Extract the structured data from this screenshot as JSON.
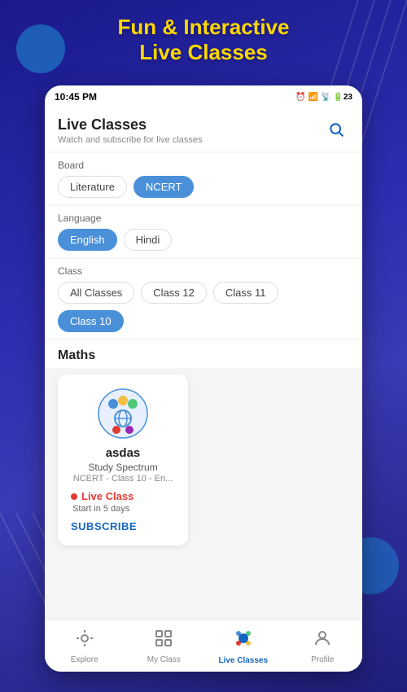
{
  "header": {
    "title_line1": "Fun & Interactive",
    "title_line2": "Live Classes"
  },
  "status_bar": {
    "time": "10:45 PM",
    "alarm_icon": "alarm-icon",
    "wifi_icon": "wifi-icon",
    "signal_icon": "signal-icon",
    "battery": "23"
  },
  "app": {
    "title": "Live Classes",
    "subtitle": "Watch and subscribe for live classes",
    "search_icon": "search-icon"
  },
  "filters": {
    "board": {
      "label": "Board",
      "options": [
        {
          "id": "literature",
          "label": "Literature",
          "active": false
        },
        {
          "id": "ncert",
          "label": "NCERT",
          "active": true
        }
      ]
    },
    "language": {
      "label": "Language",
      "options": [
        {
          "id": "english",
          "label": "English",
          "active": true
        },
        {
          "id": "hindi",
          "label": "Hindi",
          "active": false
        }
      ]
    },
    "class": {
      "label": "Class",
      "options": [
        {
          "id": "all",
          "label": "All Classes",
          "active": false
        },
        {
          "id": "class12",
          "label": "Class 12",
          "active": false
        },
        {
          "id": "class11",
          "label": "Class 11",
          "active": false
        },
        {
          "id": "class10",
          "label": "Class 10",
          "active": true
        }
      ]
    }
  },
  "subject": {
    "name": "Maths"
  },
  "card": {
    "icon_label": "class-icon",
    "title": "asdas",
    "provider": "Study Spectrum",
    "meta": "NCERT - Class 10 - En...",
    "live_status": "Live Class",
    "start_info": "Start in 5 days",
    "subscribe_label": "SUBSCRIBE"
  },
  "bottom_nav": {
    "items": [
      {
        "id": "explore",
        "label": "Explore",
        "icon": "🔍",
        "active": false
      },
      {
        "id": "my-class",
        "label": "My Class",
        "icon": "📊",
        "active": false
      },
      {
        "id": "live-classes",
        "label": "Live Classes",
        "icon": "🔗",
        "active": true
      },
      {
        "id": "profile",
        "label": "Profile",
        "icon": "👤",
        "active": false
      }
    ]
  }
}
